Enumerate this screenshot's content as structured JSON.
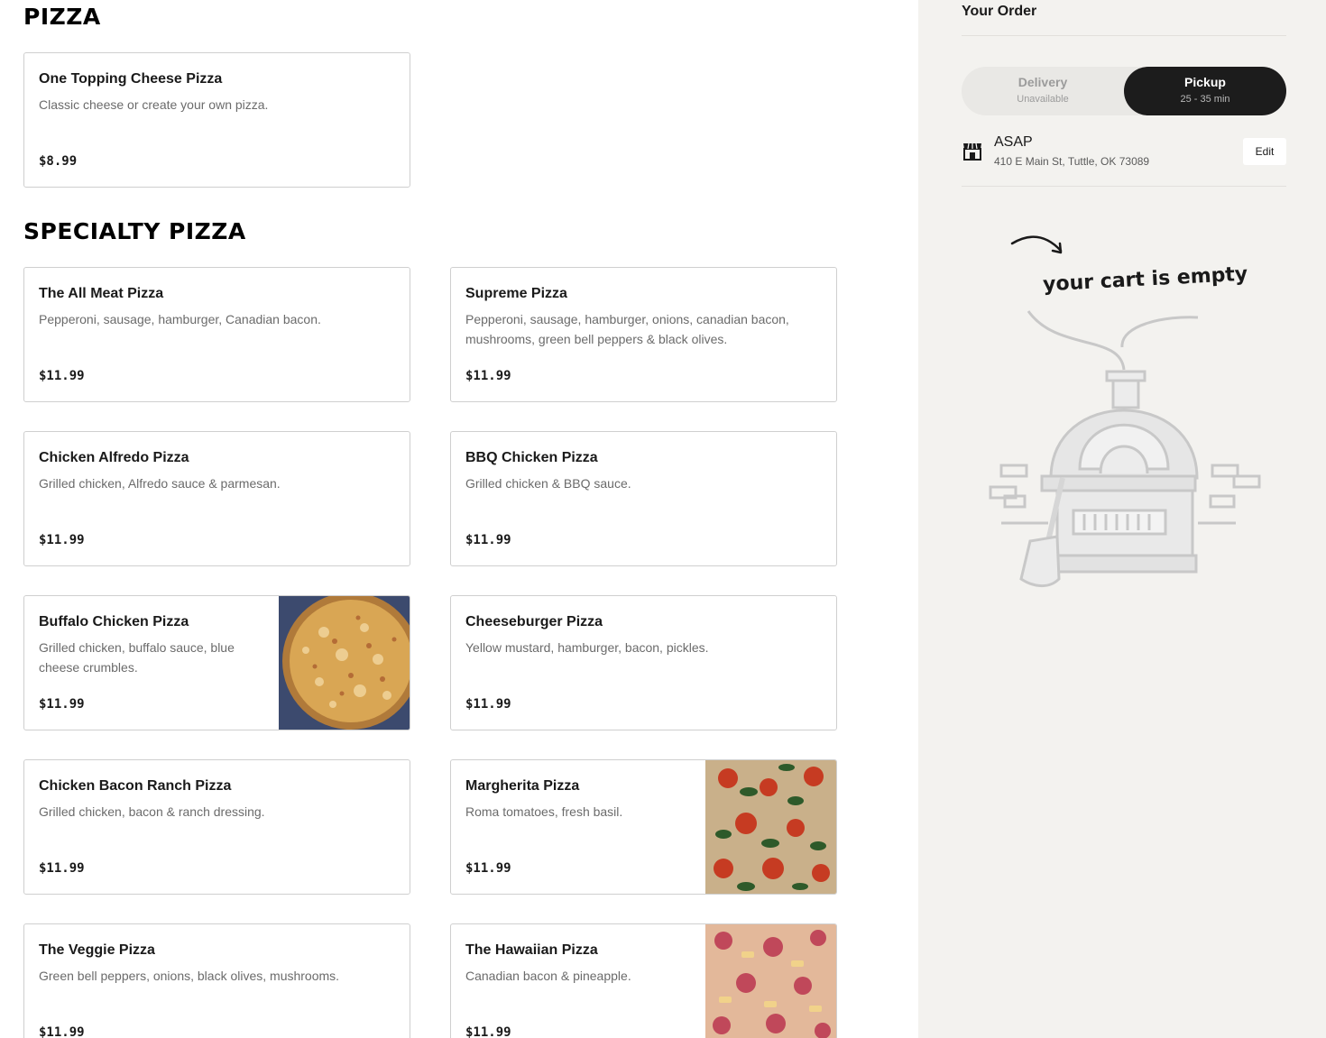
{
  "menu": {
    "sections": [
      {
        "title": "PIZZA",
        "items": [
          {
            "name": "One Topping Cheese Pizza",
            "desc": "Classic cheese or create your own pizza.",
            "price": "$8.99"
          }
        ]
      },
      {
        "title": "SPECIALTY PIZZA",
        "items": [
          {
            "name": "The All Meat Pizza",
            "desc": "Pepperoni, sausage, hamburger, Canadian bacon.",
            "price": "$11.99"
          },
          {
            "name": "Supreme Pizza",
            "desc": "Pepperoni, sausage, hamburger, onions, canadian bacon, mushrooms, green bell peppers & black olives.",
            "price": "$11.99"
          },
          {
            "name": "Chicken Alfredo Pizza",
            "desc": "Grilled chicken, Alfredo sauce & parmesan.",
            "price": "$11.99"
          },
          {
            "name": "BBQ Chicken Pizza",
            "desc": "Grilled chicken & BBQ sauce.",
            "price": "$11.99"
          },
          {
            "name": "Buffalo Chicken Pizza",
            "desc": "Grilled chicken, buffalo sauce, blue cheese crumbles.",
            "price": "$11.99"
          },
          {
            "name": "Cheeseburger Pizza",
            "desc": "Yellow mustard, hamburger, bacon, pickles.",
            "price": "$11.99"
          },
          {
            "name": "Chicken Bacon Ranch Pizza",
            "desc": "Grilled chicken, bacon & ranch dressing.",
            "price": "$11.99"
          },
          {
            "name": "Margherita Pizza",
            "desc": "Roma tomatoes, fresh basil.",
            "price": "$11.99"
          },
          {
            "name": "The Veggie Pizza",
            "desc": "Green bell peppers, onions, black olives, mushrooms.",
            "price": "$11.99"
          },
          {
            "name": "The Hawaiian Pizza",
            "desc": "Canadian bacon & pineapple.",
            "price": "$11.99"
          }
        ]
      }
    ]
  },
  "sidebar": {
    "title": "Your Order",
    "delivery": {
      "label": "Delivery",
      "sub": "Unavailable"
    },
    "pickup": {
      "label": "Pickup",
      "sub": "25 - 35 min"
    },
    "schedule": {
      "time": "ASAP",
      "address": "410 E Main St, Tuttle, OK 73089",
      "edit_label": "Edit"
    },
    "empty_cart_text": "your cart is empty"
  },
  "colors": {
    "accent_dark": "#1c1c1c",
    "sidebar_bg": "#f3f2ef",
    "card_border": "#cfcfcf"
  },
  "icons": {
    "store": "store-icon",
    "arrow": "curved-arrow-icon",
    "oven": "pizza-oven-illustration"
  }
}
